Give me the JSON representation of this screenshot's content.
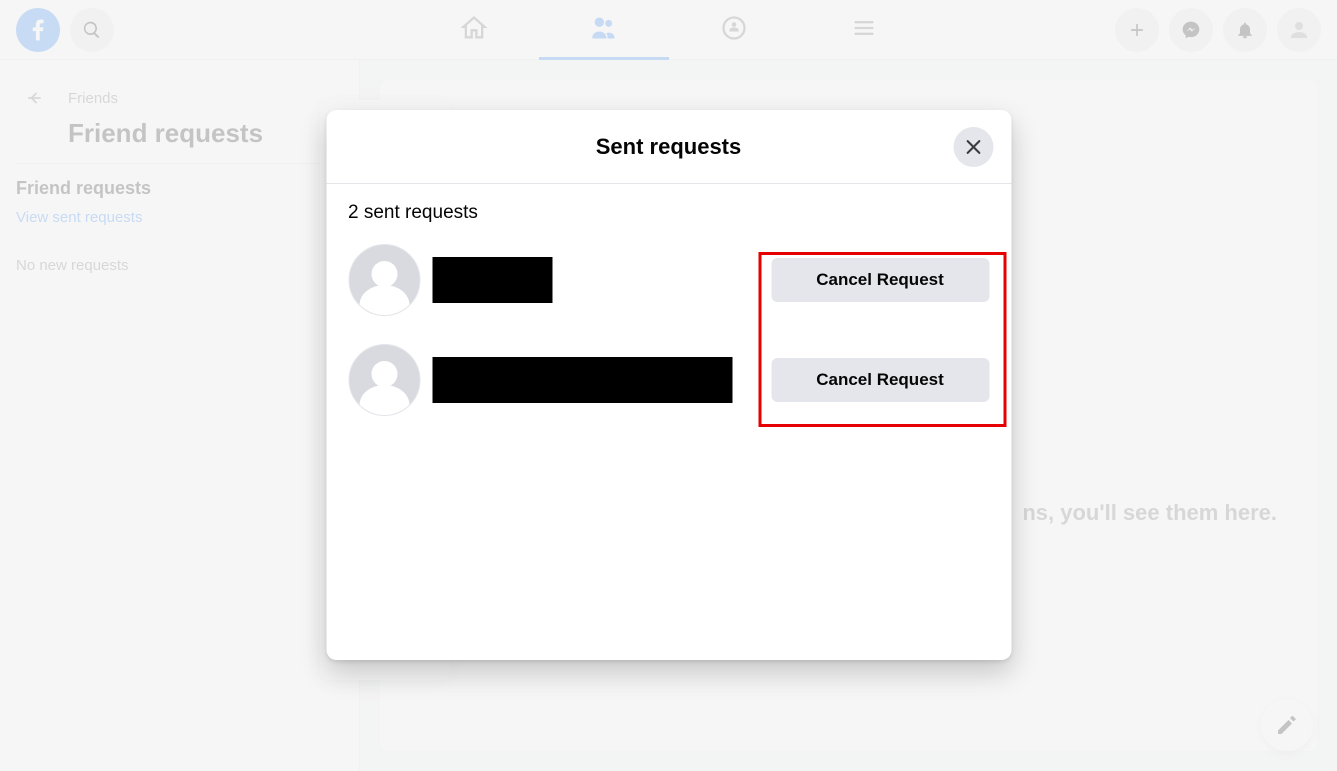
{
  "nav": {
    "tabs": [
      "home",
      "friends",
      "groups",
      "menu"
    ],
    "active_tab": "friends"
  },
  "sidebar": {
    "breadcrumb": "Friends",
    "title": "Friend requests",
    "section_heading": "Friend requests",
    "view_sent_link": "View sent requests",
    "empty_text": "No new requests"
  },
  "main": {
    "background_message": "ns, you'll see them here."
  },
  "modal": {
    "title": "Sent requests",
    "count_label": "2 sent requests",
    "requests": [
      {
        "name_redacted": true,
        "cancel_label": "Cancel Request"
      },
      {
        "name_redacted": true,
        "cancel_label": "Cancel Request"
      }
    ]
  }
}
